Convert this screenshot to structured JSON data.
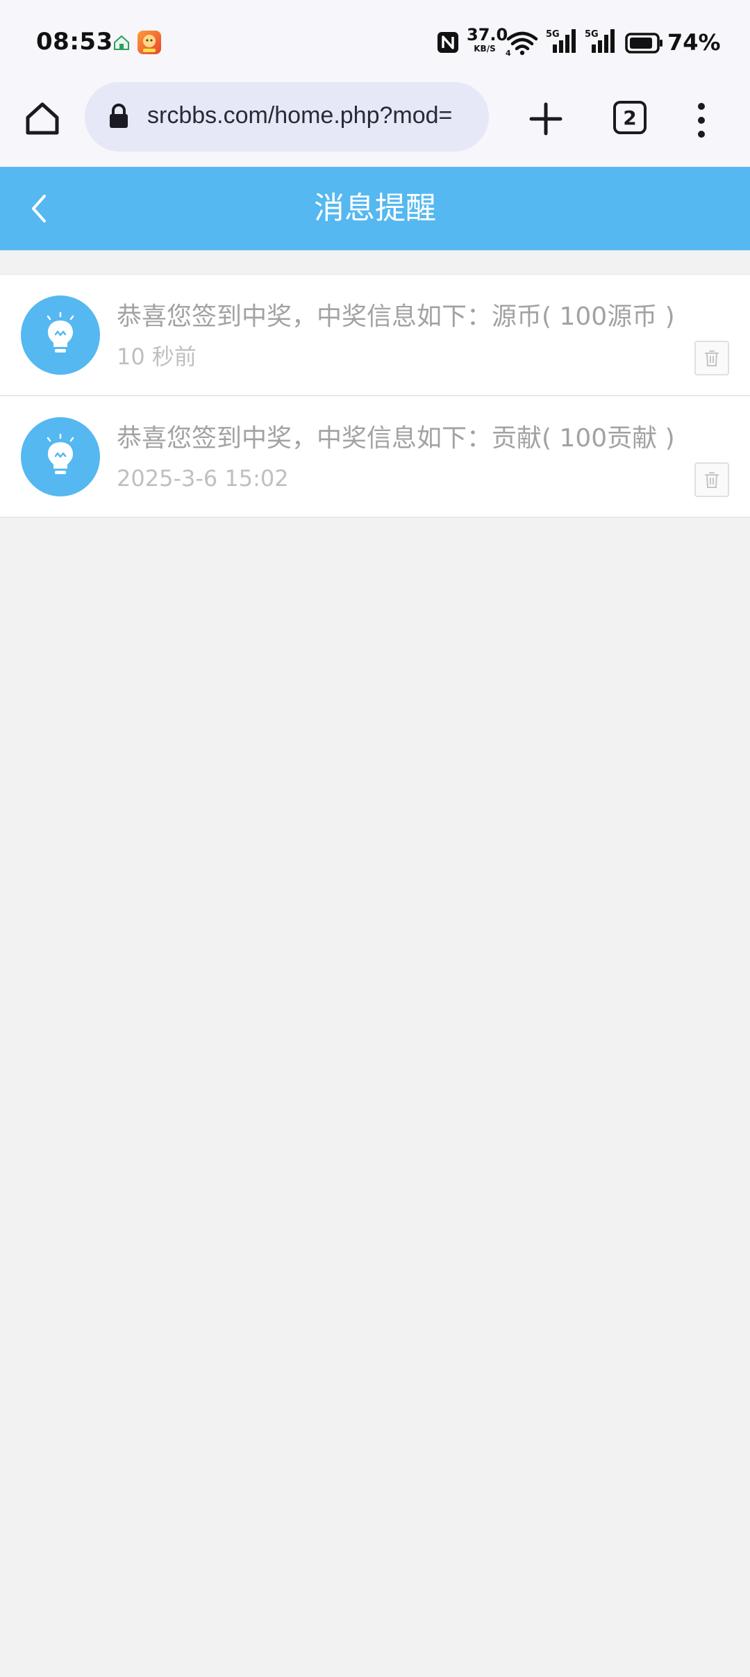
{
  "status_bar": {
    "time": "08:53",
    "net_speed_value": "37.0",
    "net_speed_unit": "KB/S",
    "battery_pct": "74%",
    "icons": [
      "home-app-icon",
      "game-app-icon",
      "nfc-icon",
      "wifi-icon",
      "signal-5g-icon",
      "signal-5g-icon",
      "battery-icon"
    ]
  },
  "browser": {
    "url": "srcbbs.com/home.php?mod=",
    "tab_count": "2"
  },
  "header": {
    "title": "消息提醒"
  },
  "messages": [
    {
      "text": "恭喜您签到中奖，中奖信息如下：源币( 100源币 )",
      "time": "10 秒前"
    },
    {
      "text": "恭喜您签到中奖，中奖信息如下：贡献( 100贡献 )",
      "time": "2025-3-6 15:02"
    }
  ],
  "colors": {
    "header_bg": "#55b8f0",
    "avatar_bg": "#55b8f0",
    "page_bg": "#f2f2f2",
    "urlbar_bg": "#e6e7f7"
  }
}
